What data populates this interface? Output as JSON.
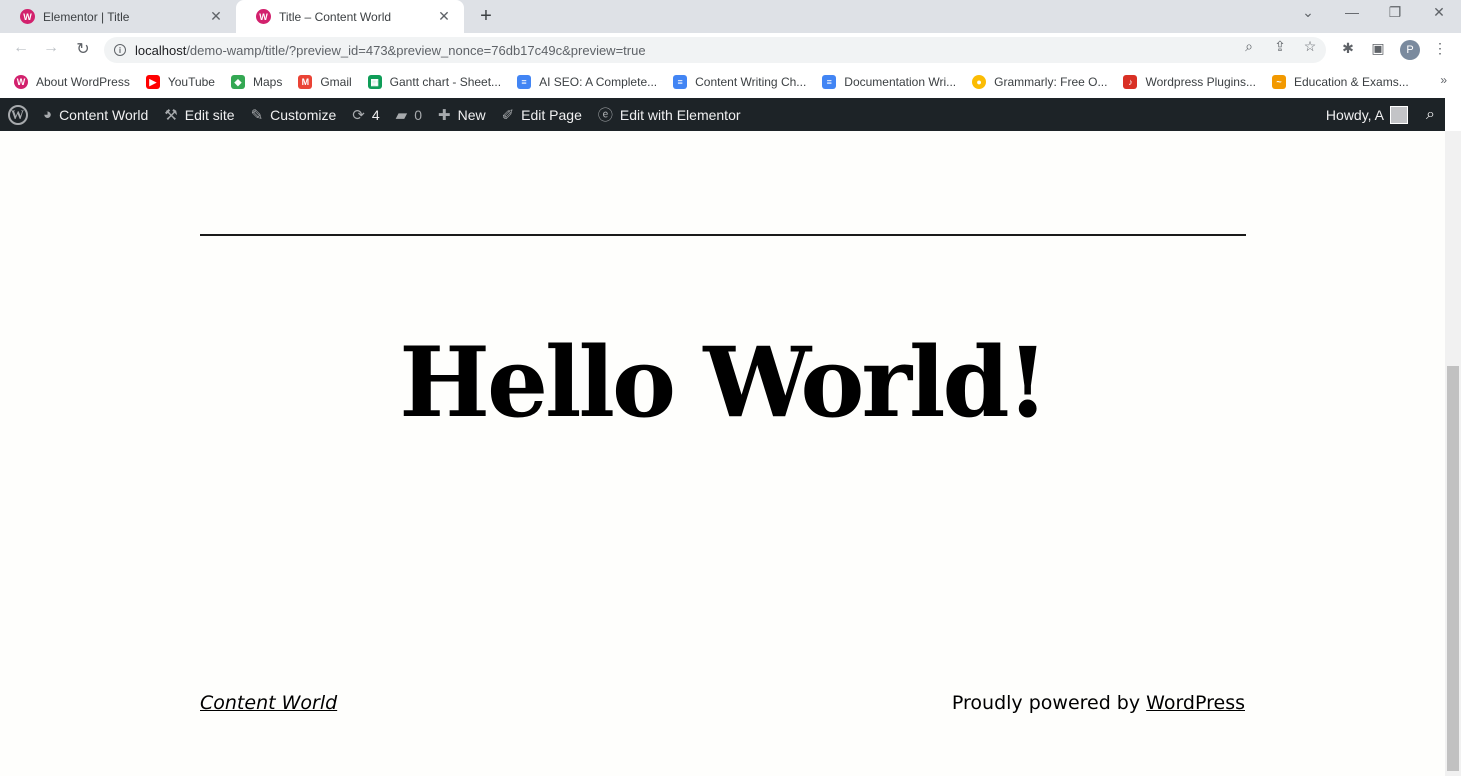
{
  "tabs": [
    {
      "title": "Elementor | Title",
      "active": false
    },
    {
      "title": "Title – Content World",
      "active": true
    }
  ],
  "address": {
    "host": "localhost",
    "path": "/demo-wamp/title/?preview_id=473&preview_nonce=76db17c49c&preview=true"
  },
  "profile_initial": "P",
  "bookmarks": [
    {
      "label": "About WordPress",
      "icon": "wordpress-icon",
      "color": "#d2216d"
    },
    {
      "label": "YouTube",
      "icon": "youtube-icon",
      "color": "#ff0000"
    },
    {
      "label": "Maps",
      "icon": "maps-icon",
      "color": "#34a853"
    },
    {
      "label": "Gmail",
      "icon": "gmail-icon",
      "color": "#ea4335"
    },
    {
      "label": "Gantt chart - Sheet...",
      "icon": "sheets-icon",
      "color": "#0f9d58"
    },
    {
      "label": "AI SEO: A Complete...",
      "icon": "docs-icon",
      "color": "#4285f4"
    },
    {
      "label": "Content Writing Ch...",
      "icon": "docs-icon",
      "color": "#4285f4"
    },
    {
      "label": "Documentation Wri...",
      "icon": "docs-icon",
      "color": "#4285f4"
    },
    {
      "label": "Grammarly: Free O...",
      "icon": "chrome-store-icon",
      "color": "#fbbc04"
    },
    {
      "label": "Wordpress Plugins...",
      "icon": "plugins-icon",
      "color": "#d93025"
    },
    {
      "label": "Education & Exams...",
      "icon": "education-icon",
      "color": "#f29900"
    }
  ],
  "adminbar": {
    "site_name": "Content World",
    "edit_site": "Edit site",
    "customize": "Customize",
    "updates_count": "4",
    "comments_count": "0",
    "new": "New",
    "edit_page": "Edit Page",
    "edit_elementor": "Edit with Elementor",
    "howdy": "Howdy, A"
  },
  "page": {
    "headline": "Hello World!",
    "footer_site": "Content World",
    "footer_powered_prefix": "Proudly powered by ",
    "footer_powered_link": "WordPress"
  }
}
